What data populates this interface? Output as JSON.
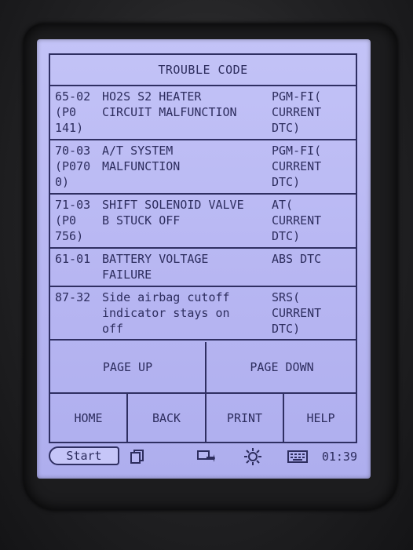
{
  "window": {
    "title": "TROUBLE CODE"
  },
  "codes": [
    {
      "code": "65-02\n(P0\n141)",
      "description": "HO2S S2 HEATER\nCIRCUIT MALFUNCTION",
      "system": "PGM-FI(\nCURRENT\nDTC)"
    },
    {
      "code": "70-03\n(P070\n0)",
      "description": "A/T SYSTEM\nMALFUNCTION",
      "system": "PGM-FI(\nCURRENT\nDTC)"
    },
    {
      "code": "71-03\n(P0\n756)",
      "description": "SHIFT SOLENOID VALVE\nB STUCK OFF",
      "system": "AT(\nCURRENT\nDTC)"
    },
    {
      "code": "61-01",
      "description": "BATTERY VOLTAGE\nFAILURE",
      "system": "ABS DTC"
    },
    {
      "code": "87-32",
      "description": "Side airbag cutoff\nindicator stays on\noff",
      "system": "SRS(\nCURRENT\nDTC)"
    }
  ],
  "buttons": {
    "page_up": "PAGE UP",
    "page_down": "PAGE DOWN",
    "home": "HOME",
    "back": "BACK",
    "print": "PRINT",
    "help": "HELP"
  },
  "taskbar": {
    "start": "Start",
    "time": "01:39",
    "icons": [
      "window-icon",
      "display-arrow-icon",
      "brightness-icon",
      "keyboard-icon"
    ]
  },
  "colors": {
    "screen": "#b7b6f2",
    "ink": "#2d2d5e",
    "bezel": "#1c1c1e"
  }
}
